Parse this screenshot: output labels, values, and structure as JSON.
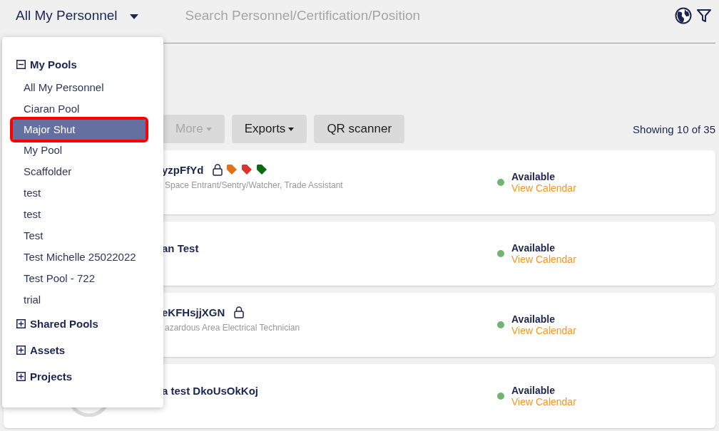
{
  "selector": {
    "label": "All My Personnel"
  },
  "search": {
    "placeholder": "Search Personnel/Certification/Position"
  },
  "toolbar": {
    "buttons": [
      {
        "label": "More",
        "disabled": true,
        "caret": true
      },
      {
        "label": "Exports",
        "disabled": false,
        "caret": true
      },
      {
        "label": "QR scanner",
        "disabled": false,
        "caret": false
      }
    ],
    "count": "Showing 10 of 35"
  },
  "cards": [
    {
      "name": "yzpFfYd",
      "locked": true,
      "tags": [
        {
          "color": "#e0701a"
        },
        {
          "color": "#e03030"
        },
        {
          "color": "#0b6a12"
        }
      ],
      "role": "Space Entrant/Sentry/Watcher, Trade Assistant",
      "status": "Available",
      "link": "View Calendar"
    },
    {
      "name": "an Test",
      "locked": false,
      "status": "Available",
      "link": "View Calendar"
    },
    {
      "name": "eKFHsjjXGN",
      "locked": true,
      "role": "azardous Area Electrical Technician",
      "status": "Available",
      "link": "View Calendar"
    },
    {
      "name": "a test DkoUsOkKoj",
      "locked": false,
      "avatar": true,
      "status": "Available",
      "link": "View Calendar"
    }
  ],
  "dropdown": {
    "sections": [
      {
        "label": "My Pools",
        "expanded": true,
        "items": [
          {
            "label": "All My Personnel",
            "selected": false
          },
          {
            "label": "Ciaran Pool",
            "selected": false
          },
          {
            "label": "Major Shut",
            "selected": true
          },
          {
            "label": "My Pool",
            "selected": false
          },
          {
            "label": "Scaffolder",
            "selected": false
          },
          {
            "label": "test",
            "selected": false
          },
          {
            "label": "test",
            "selected": false
          },
          {
            "label": "Test",
            "selected": false
          },
          {
            "label": "Test Michelle 25022022",
            "selected": false
          },
          {
            "label": "Test Pool - 722",
            "selected": false
          },
          {
            "label": "trial",
            "selected": false
          }
        ]
      },
      {
        "label": "Shared Pools",
        "expanded": false
      },
      {
        "label": "Assets",
        "expanded": false
      },
      {
        "label": "Projects",
        "expanded": false
      }
    ]
  }
}
